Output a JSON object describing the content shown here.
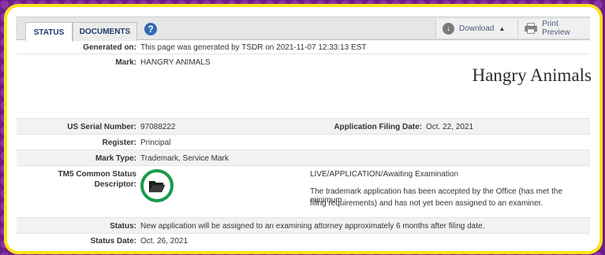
{
  "tabs": [
    {
      "label": "STATUS",
      "active": true
    },
    {
      "label": "DOCUMENTS",
      "active": false
    }
  ],
  "toolbar": {
    "help_icon": "question-circle-icon",
    "help_glyph": "?",
    "download_label": "Download",
    "download_caret": "▲",
    "print_label": "Print Preview"
  },
  "fields": {
    "generated_on": {
      "label": "Generated on:",
      "value": "This page was generated by TSDR on 2021-11-07 12:33:13 EST"
    },
    "mark": {
      "label": "Mark:",
      "value": "HANGRY ANIMALS",
      "display": "Hangry Animals"
    },
    "serial": {
      "label": "US Serial Number:",
      "value": "97088222"
    },
    "filing_date": {
      "label": "Application Filing Date:",
      "value": "Oct. 22, 2021"
    },
    "register": {
      "label": "Register:",
      "value": "Principal"
    },
    "mark_type": {
      "label": "Mark Type:",
      "value": "Trademark, Service Mark"
    },
    "tm5": {
      "label_line1": "TM5 Common Status",
      "label_line2": "Descriptor:",
      "status_code": "LIVE/APPLICATION/Awaiting Examination",
      "description_line1": "The trademark application has been accepted by the Office (has met the minimum",
      "description_line2": "filing requirements) and has not yet been assigned to an examiner.",
      "icon": "open-folder-icon",
      "icon_color": "#1a9a4a"
    },
    "status": {
      "label": "Status:",
      "value": "New application will be assigned to an examining attorney approximately 6 months after filing date."
    },
    "status_date": {
      "label": "Status Date:",
      "value": "Oct. 26, 2021"
    }
  },
  "colors": {
    "frame": "#ffe21a",
    "background": "#6b1f86",
    "tab_text": "#1f3a6b"
  }
}
